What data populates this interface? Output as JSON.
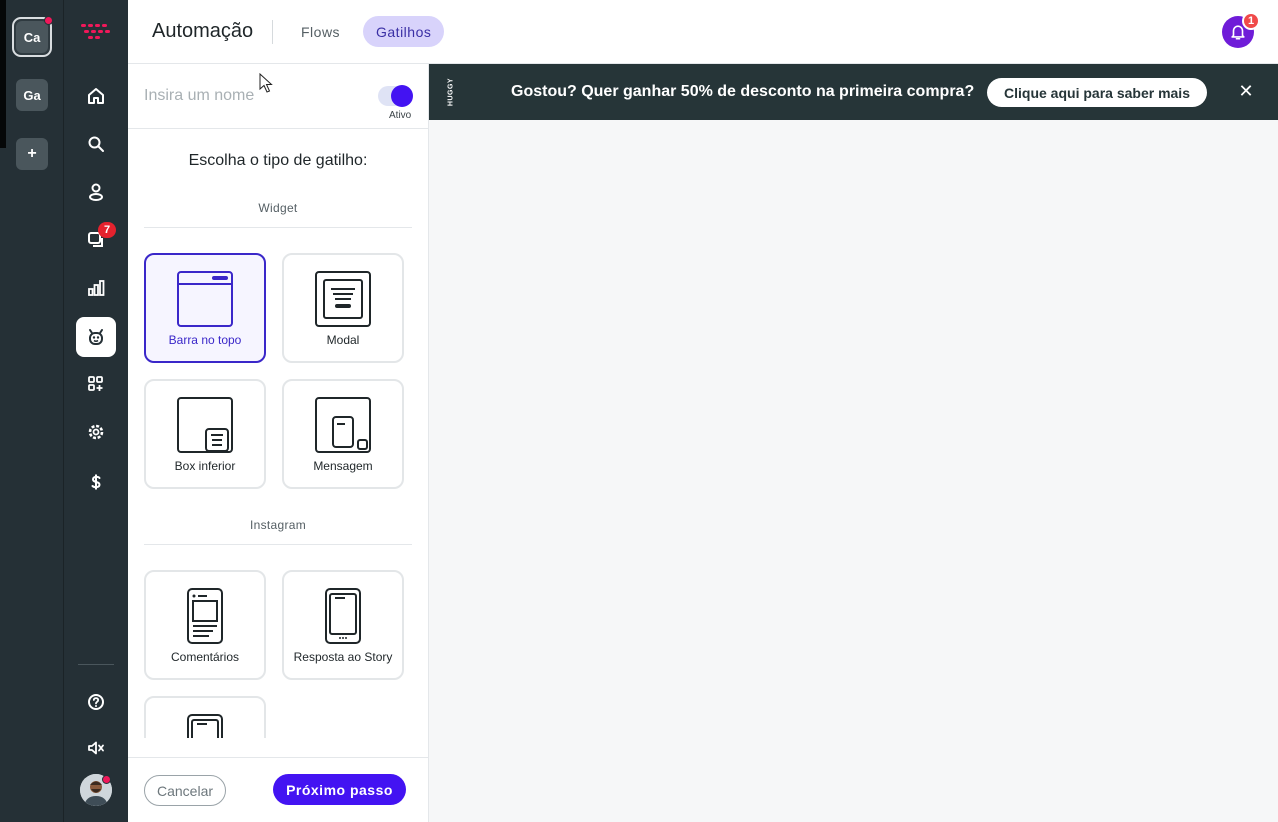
{
  "workspaces": [
    {
      "initials": "Ca",
      "active": true
    },
    {
      "initials": "Ga",
      "active": false
    }
  ],
  "workspace_add": "+",
  "nav": {
    "items": [
      {
        "icon": "home-icon"
      },
      {
        "icon": "search-icon"
      },
      {
        "icon": "contacts-icon"
      },
      {
        "icon": "chat-icon",
        "badge": "7"
      },
      {
        "icon": "reports-icon"
      },
      {
        "icon": "bot-icon",
        "active": true
      },
      {
        "icon": "apps-icon"
      },
      {
        "icon": "settings-icon"
      },
      {
        "icon": "dollar-icon"
      }
    ],
    "bottom": [
      {
        "icon": "help-icon"
      },
      {
        "icon": "mute-icon"
      }
    ]
  },
  "header": {
    "title": "Automação",
    "tabs": [
      {
        "label": "Flows",
        "active": false
      },
      {
        "label": "Gatilhos",
        "active": true
      }
    ],
    "notifications": "1"
  },
  "panel": {
    "name_placeholder": "Insira um nome",
    "toggle_label": "Ativo",
    "choose_title": "Escolha o tipo de gatilho:",
    "sections": [
      {
        "label": "Widget",
        "cards": [
          {
            "label": "Barra no topo",
            "icon": "top-bar-icon",
            "selected": true
          },
          {
            "label": "Modal",
            "icon": "modal-icon",
            "selected": false
          },
          {
            "label": "Box inferior",
            "icon": "bottom-box-icon",
            "selected": false
          },
          {
            "label": "Mensagem",
            "icon": "message-icon",
            "selected": false
          }
        ]
      },
      {
        "label": "Instagram",
        "cards": [
          {
            "label": "Comentários",
            "icon": "comments-icon",
            "selected": false
          },
          {
            "label": "Resposta ao Story",
            "icon": "story-reply-icon",
            "selected": false
          },
          {
            "label": "",
            "icon": "instagram-direct-icon",
            "selected": false
          }
        ]
      }
    ],
    "cancel_label": "Cancelar",
    "next_label": "Próximo passo"
  },
  "preview": {
    "brand": "HUGGY",
    "message": "Gostou? Quer ganhar 50% de desconto na primeira compra?",
    "cta": "Clique aqui para saber mais",
    "close": "✕"
  },
  "colors": {
    "primary": "#4313f2",
    "sidebar": "#253036",
    "topbar": "#263538",
    "accent_pink": "#f0185a"
  }
}
